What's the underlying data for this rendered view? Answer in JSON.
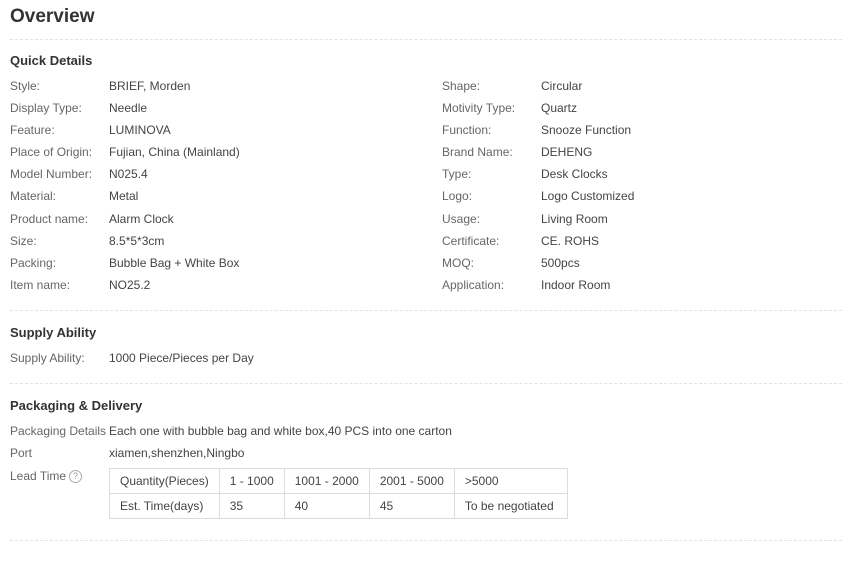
{
  "title": "Overview",
  "quick_details": {
    "heading": "Quick Details",
    "left": [
      {
        "label": "Style:",
        "value": "BRIEF, Morden"
      },
      {
        "label": "Display Type:",
        "value": "Needle"
      },
      {
        "label": "Feature:",
        "value": "LUMINOVA"
      },
      {
        "label": "Place of Origin:",
        "value": "Fujian, China (Mainland)"
      },
      {
        "label": "Model Number:",
        "value": "N025.4"
      },
      {
        "label": "Material:",
        "value": "Metal"
      },
      {
        "label": "Product name:",
        "value": "Alarm Clock"
      },
      {
        "label": "Size:",
        "value": "8.5*5*3cm"
      },
      {
        "label": "Packing:",
        "value": "Bubble Bag + White Box"
      },
      {
        "label": "Item name:",
        "value": "NO25.2"
      }
    ],
    "right": [
      {
        "label": "Shape:",
        "value": "Circular"
      },
      {
        "label": "Motivity Type:",
        "value": "Quartz"
      },
      {
        "label": "Function:",
        "value": "Snooze Function"
      },
      {
        "label": "Brand Name:",
        "value": "DEHENG"
      },
      {
        "label": "Type:",
        "value": "Desk Clocks"
      },
      {
        "label": "Logo:",
        "value": "Logo Customized"
      },
      {
        "label": "Usage:",
        "value": "Living Room"
      },
      {
        "label": "Certificate:",
        "value": "CE. ROHS"
      },
      {
        "label": "MOQ:",
        "value": "500pcs"
      },
      {
        "label": "Application:",
        "value": "Indoor Room"
      }
    ]
  },
  "supply": {
    "heading": "Supply Ability",
    "label": "Supply Ability:",
    "value": "1000 Piece/Pieces per Day"
  },
  "packaging": {
    "heading": "Packaging & Delivery",
    "details_label": "Packaging Details",
    "details_value": "Each one with bubble bag and white box,40 PCS into one carton",
    "port_label": "Port",
    "port_value": "xiamen,shenzhen,Ningbo",
    "lead_label": "Lead Time",
    "help_icon": "?",
    "lead_table": {
      "header": [
        "Quantity(Pieces)",
        "1 - 1000",
        "1001 - 2000",
        "2001 - 5000",
        ">5000"
      ],
      "row": [
        "Est. Time(days)",
        "35",
        "40",
        "45",
        "To be negotiated"
      ]
    }
  }
}
